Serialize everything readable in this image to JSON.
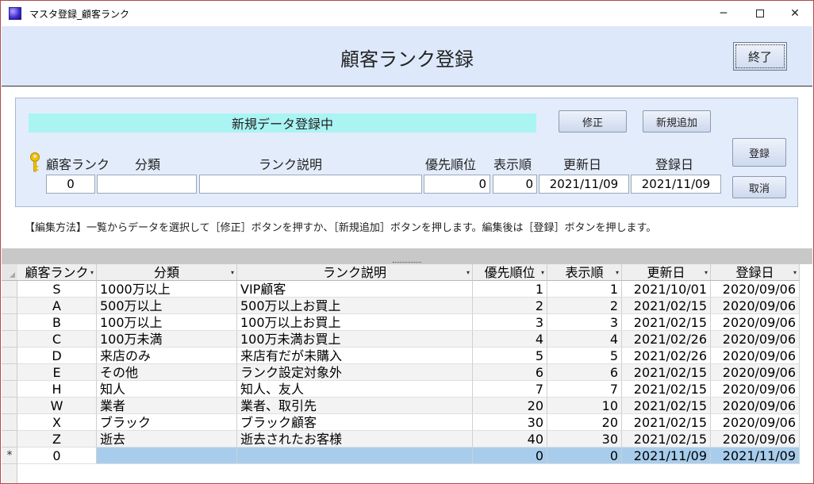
{
  "window": {
    "title": "マスタ登録_顧客ランク",
    "minimize": "─",
    "close": "✕"
  },
  "header": {
    "title": "顧客ランク登録",
    "end_button": "終了"
  },
  "panel": {
    "status": "新規データ登録中",
    "buttons": {
      "modify": "修正",
      "add_new": "新規追加",
      "register": "登録",
      "cancel": "取消"
    },
    "labels": {
      "rank": "顧客ランク",
      "category": "分類",
      "description": "ランク説明",
      "priority": "優先順位",
      "display_order": "表示順",
      "updated": "更新日",
      "registered": "登録日"
    },
    "fields": {
      "rank": "0",
      "category": "",
      "description": "",
      "priority": "0",
      "display_order": "0",
      "updated": "2021/11/09",
      "registered": "2021/11/09"
    }
  },
  "help_text": "【編集方法】一覧からデータを選択して［修正］ボタンを押すか、［新規追加］ボタンを押します。編集後は［登録］ボタンを押します。",
  "grid": {
    "columns": [
      "顧客ランク",
      "分類",
      "ランク説明",
      "優先順位",
      "表示順",
      "更新日",
      "登録日"
    ],
    "sort_glyph": "▾",
    "rows": [
      [
        "S",
        "1000万以上",
        "VIP顧客",
        "1",
        "1",
        "2021/10/01",
        "2020/09/06"
      ],
      [
        "A",
        "500万以上",
        "500万以上お買上",
        "2",
        "2",
        "2021/02/15",
        "2020/09/06"
      ],
      [
        "B",
        "100万以上",
        "100万以上お買上",
        "3",
        "3",
        "2021/02/15",
        "2020/09/06"
      ],
      [
        "C",
        "100万未満",
        "100万未満お買上",
        "4",
        "4",
        "2021/02/26",
        "2020/09/06"
      ],
      [
        "D",
        "来店のみ",
        "来店有だが未購入",
        "5",
        "5",
        "2021/02/26",
        "2020/09/06"
      ],
      [
        "E",
        "その他",
        "ランク設定対象外",
        "6",
        "6",
        "2021/02/15",
        "2020/09/06"
      ],
      [
        "H",
        "知人",
        "知人、友人",
        "7",
        "7",
        "2021/02/15",
        "2020/09/06"
      ],
      [
        "W",
        "業者",
        "業者、取引先",
        "20",
        "10",
        "2021/02/15",
        "2020/09/06"
      ],
      [
        "X",
        "ブラック",
        "ブラック顧客",
        "30",
        "20",
        "2021/02/15",
        "2020/09/06"
      ],
      [
        "Z",
        "逝去",
        "逝去されたお客様",
        "40",
        "30",
        "2021/02/15",
        "2020/09/06"
      ]
    ],
    "new_row": {
      "marker": "*",
      "values": [
        "0",
        "",
        "",
        "0",
        "0",
        "2021/11/09",
        "2021/11/09"
      ]
    }
  },
  "colors": {
    "header_bg": "#dde8fb",
    "panel_bg": "#e3ecfa",
    "status_bg": "#aaf4f4",
    "selected_row": "#a8cdec",
    "window_border": "#b24a4a"
  }
}
